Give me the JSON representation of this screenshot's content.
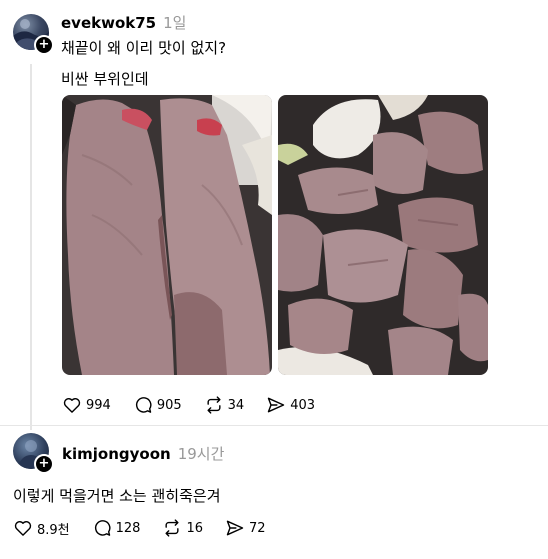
{
  "post": {
    "username": "evekwok75",
    "time": "1일",
    "text": "채끝이 왜 이리 맛이 없지?",
    "reply_text": "비싼 부위인데",
    "likes": "994",
    "comments": "905",
    "reposts": "34",
    "shares": "403"
  },
  "comment": {
    "username": "kimjongyoon",
    "time": "19시간",
    "text": "이렇게 먹을거면 소는 괜히죽은겨",
    "likes": "8.9천",
    "comments": "128",
    "reposts": "16",
    "shares": "72"
  },
  "icons": {
    "like": "heart-icon",
    "comment": "speech-bubble-icon",
    "repost": "repost-arrows-icon",
    "share": "send-arrow-icon",
    "follow": "plus-icon"
  },
  "colors": {
    "meat": "#a7868a",
    "meat_dark": "#7a5558",
    "onion": "#eee9e4",
    "pan": "#3a3434",
    "muted_text": "#999999"
  }
}
